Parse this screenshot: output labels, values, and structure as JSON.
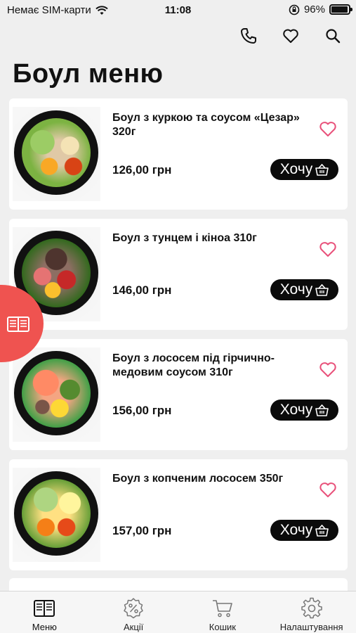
{
  "status_bar": {
    "carrier": "Немає SIM-карти",
    "time": "11:08",
    "battery": "96%",
    "battery_level": 0.96
  },
  "header": {
    "title": "Боул меню"
  },
  "buy_label": "Хочу",
  "products": [
    {
      "name": "Боул з куркою та соусом «Цезар» 320г",
      "price": "126,00 грн"
    },
    {
      "name": "Боул з тунцем і кіноа 310г",
      "price": "146,00 грн"
    },
    {
      "name": "Боул з лососем під гірчично-медовим соусом 310г",
      "price": "156,00 грн"
    },
    {
      "name": "Боул з копченим лососем 350г",
      "price": "157,00 грн"
    }
  ],
  "tabbar": [
    {
      "label": "Меню"
    },
    {
      "label": "Акції"
    },
    {
      "label": "Кошик"
    },
    {
      "label": "Налаштування"
    }
  ],
  "colors": {
    "accent": "#ef5350",
    "heart": "#e8517a",
    "button": "#0b0b0b"
  }
}
